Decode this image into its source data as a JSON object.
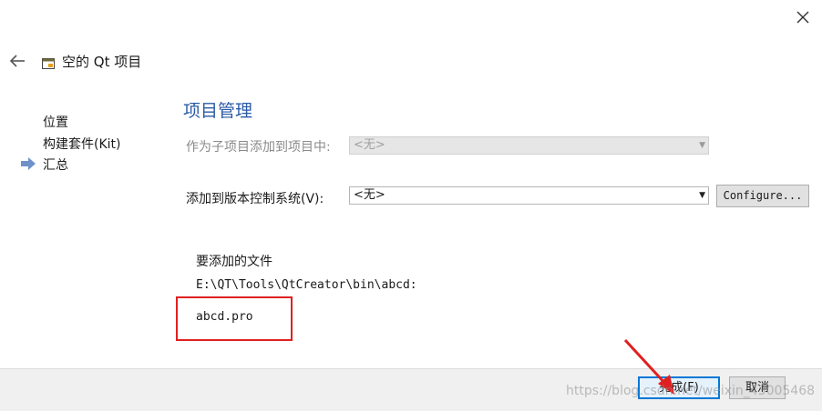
{
  "header": {
    "title": "空的 Qt 项目",
    "close_icon": "close-icon",
    "back_icon": "back-arrow-icon",
    "title_icon": "project-window-icon"
  },
  "sidebar": {
    "items": [
      {
        "label": "位置",
        "current": false
      },
      {
        "label": "构建套件(Kit)",
        "current": false
      },
      {
        "label": "汇总",
        "current": true
      }
    ],
    "current_marker_icon": "right-arrow-icon"
  },
  "main": {
    "section_title": "项目管理",
    "add_as_subproject": {
      "label": "作为子项目添加到项目中:",
      "value": "<无>",
      "enabled": false
    },
    "version_control": {
      "label": "添加到版本控制系统(V):",
      "value": "<无>",
      "configure_label": "Configure..."
    },
    "files": {
      "heading": "要添加的文件",
      "path": "E:\\QT\\Tools\\QtCreator\\bin\\abcd:",
      "file": "abcd.pro"
    }
  },
  "footer": {
    "finish_label": "完成(F)",
    "cancel_label": "取消"
  },
  "overlay": {
    "watermark": "https://blog.csdn.net/weixin_43005468",
    "highlight_color": "#e02020",
    "accent_color": "#0078d7"
  }
}
